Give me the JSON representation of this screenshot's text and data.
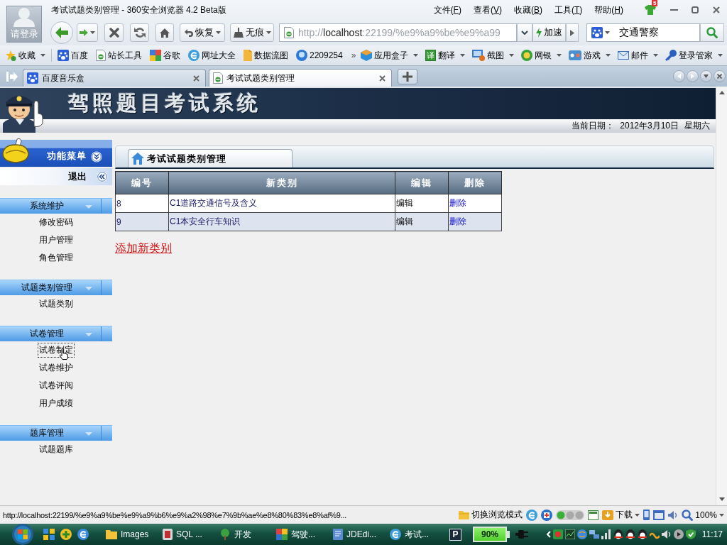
{
  "browser": {
    "account_label": "请登录",
    "title": "考试试题类别管理 - 360安全浏览器 4.2 Beta版",
    "menu": [
      "文件(F)",
      "查看(V)",
      "收藏(B)",
      "工具(T)",
      "帮助(H)"
    ],
    "notification_count": "5",
    "restore_label": "恢复",
    "incognito_label": "无痕",
    "address": {
      "scheme": "http://",
      "host": "localhost",
      "path": ":22199/%e9%a9%be%e9%a99"
    },
    "accelerate_label": "加速",
    "search_value": "交通警察",
    "favorites_label": "收藏",
    "bookmarks": [
      "百度",
      "站长工具",
      "谷歌",
      "网址大全",
      "数据流图",
      "2209254"
    ],
    "bookmarks_more": "»",
    "tools": [
      {
        "label": "应用盒子"
      },
      {
        "label": "翻译",
        "icon_text": "译"
      },
      {
        "label": "截图"
      },
      {
        "label": "网银"
      },
      {
        "label": "游戏"
      },
      {
        "label": "邮件"
      },
      {
        "label": "登录管家"
      }
    ],
    "tabs": [
      {
        "label": "百度音乐盒",
        "selected": false
      },
      {
        "label": "考试试题类别管理",
        "selected": true
      }
    ]
  },
  "page": {
    "system_title": "驾照题目考试系统",
    "date_label": "当前日期：",
    "date": "2012年3月10日",
    "weekday": "星期六"
  },
  "sidebar": {
    "title": "功能菜单",
    "logout_label": "退出",
    "sections": [
      {
        "title": "系统维护",
        "items": [
          {
            "label": "修改密码",
            "focused": false
          },
          {
            "label": "用户管理",
            "focused": false
          },
          {
            "label": "角色管理",
            "focused": false
          }
        ]
      },
      {
        "title": "试题类别管理",
        "items": [
          {
            "label": "试题类别",
            "focused": false
          }
        ]
      },
      {
        "title": "试卷管理",
        "items": [
          {
            "label": "试卷制定",
            "focused": true
          },
          {
            "label": "试卷维护",
            "focused": false
          },
          {
            "label": "试卷评阅",
            "focused": false
          },
          {
            "label": "用户成绩",
            "focused": false
          }
        ]
      },
      {
        "title": "题库管理",
        "items": [
          {
            "label": "试题题库",
            "focused": false
          }
        ]
      }
    ]
  },
  "main": {
    "panel_title": "考试试题类别管理",
    "table": {
      "columns": [
        "编号",
        "新类别",
        "编辑",
        "删除"
      ],
      "rows": [
        {
          "id": "8",
          "name": "C1道路交通信号及含义",
          "edit": "编辑",
          "delete": "删除"
        },
        {
          "id": "9",
          "name": "C1本安全行车知识",
          "edit": "编辑",
          "delete": "删除"
        }
      ]
    },
    "add_link": "添加新类别"
  },
  "status_bar": {
    "url": "http://localhost:22199/%e9%a9%be%e9%a9%b6%e9%a2%98%e7%9b%ae%e8%80%83%e8%af%9...",
    "mode_label": "切换浏览模式",
    "download_label": "下载",
    "zoom": "100%"
  },
  "taskbar": {
    "tasks": [
      "Images",
      "SQL ...",
      "开发",
      "驾驶...",
      "JDEdi...",
      "考试..."
    ],
    "app_letter": "P",
    "meter": "90%",
    "time": "11:17"
  }
}
